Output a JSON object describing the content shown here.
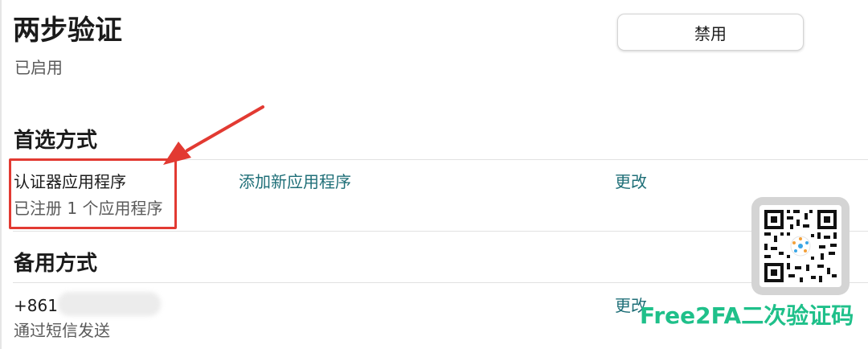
{
  "header": {
    "title": "两步验证",
    "status": "已启用",
    "disable_label": "禁用"
  },
  "preferred": {
    "section_title": "首选方式",
    "method_name": "认证器应用程序",
    "method_detail": "已注册 1 个应用程序",
    "add_link": "添加新应用程序",
    "change_link": "更改"
  },
  "backup": {
    "section_title": "备用方式",
    "phone_prefix": "+861",
    "method_detail": "通过短信发送",
    "change_link": "更改"
  },
  "watermark": {
    "text": "Free2FA二次验证码"
  },
  "colors": {
    "link": "#1f6f78",
    "annotation": "#e23a32",
    "watermark": "#1fc08a"
  }
}
